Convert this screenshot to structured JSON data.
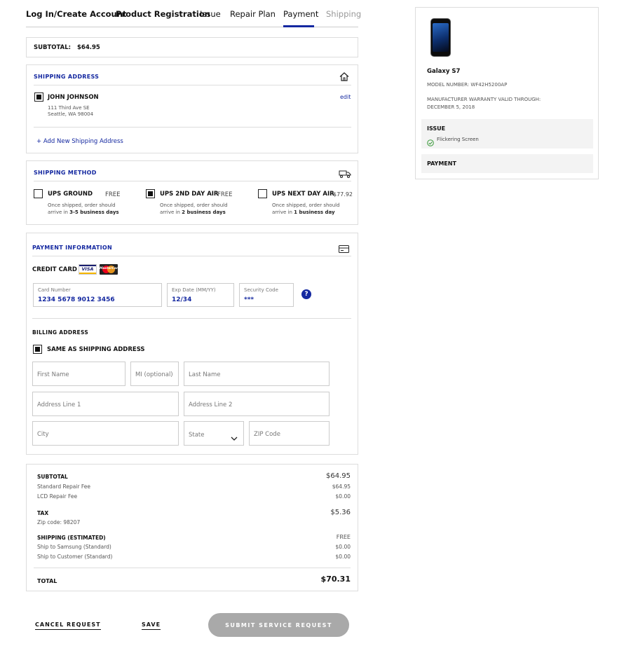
{
  "tabs": [
    {
      "label": "Log In/Create Account"
    },
    {
      "label": "Product Registration"
    },
    {
      "label": "Issue"
    },
    {
      "label": "Repair Plan"
    },
    {
      "label": "Payment"
    },
    {
      "label": "Shipping"
    }
  ],
  "subtotal_bar": {
    "label": "SUBTOTAL:",
    "value": "$64.95"
  },
  "shipping_address": {
    "title": "SHIPPING ADDRESS",
    "name": "JOHN JOHNSON",
    "line1": "111 Third Ave SE",
    "line2": "Seattle, WA 98004",
    "edit": "edit",
    "add_new": "+  Add New Shipping Address"
  },
  "shipping_method": {
    "title": "SHIPPING METHOD",
    "options": [
      {
        "name": "UPS GROUND",
        "price": "FREE",
        "desc_pre": "Once shipped, order should arrive in ",
        "desc_bold": "3-5 business days"
      },
      {
        "name": "UPS 2ND DAY AIR",
        "price": "FREE",
        "desc_pre": "Once shipped, order should arrive in ",
        "desc_bold": "2 business days"
      },
      {
        "name": "UPS NEXT DAY AIR",
        "price": "$77.92",
        "desc_pre": "Once shipped, order should arrive in ",
        "desc_bold": "1 business day"
      }
    ]
  },
  "payment": {
    "title": "PAYMENT INFORMATION",
    "credit_card": "CREDIT CARD",
    "visa": "VISA",
    "mastercard": "MasterCard",
    "card_number_label": "Card Number",
    "card_number_value": "1234 5678 9012 3456",
    "exp_label": "Exp Date (MM/YY)",
    "exp_value": "12/34",
    "cvv_label": "Security Code",
    "cvv_value": "***",
    "help": "?",
    "billing_title": "BILLING ADDRESS",
    "same_as": "SAME AS SHIPPING ADDRESS",
    "placeholders": {
      "first": "First Name",
      "mi": "MI (optional)",
      "last": "Last Name",
      "addr1": "Address Line 1",
      "addr2": "Address Line 2",
      "city": "City",
      "state": "State",
      "zip": "ZIP Code"
    }
  },
  "summary": {
    "subtotal_label": "SUBTOTAL",
    "subtotal_value": "$64.95",
    "standard_fee_label": "Standard Repair Fee",
    "standard_fee_value": "$64.95",
    "lcd_fee_label": "LCD Repair Fee",
    "lcd_fee_value": "$0.00",
    "tax_label": "TAX",
    "tax_value": "$5.36",
    "zip_label": "Zip code: 98207",
    "shipping_label": "SHIPPING (ESTIMATED)",
    "shipping_value": "FREE",
    "ship_samsung_label": "Ship to Samsung (Standard)",
    "ship_samsung_value": "$0.00",
    "ship_customer_label": "Ship to Customer (Standard)",
    "ship_customer_value": "$0.00",
    "total_label": "TOTAL",
    "total_value": "$70.31"
  },
  "actions": {
    "cancel": "CANCEL REQUEST",
    "save": "SAVE",
    "submit": "SUBMIT SERVICE REQUEST"
  },
  "sidebar": {
    "product_name": "Galaxy S7",
    "model": "MODEL NUMBER: WF42H5200AP",
    "warranty": "MANUFACTURER WARRANTY VALID THROUGH: DECEMBER 5, 2018",
    "issue_title": "ISSUE",
    "issue_item": "Flickering Screen",
    "payment_title": "PAYMENT"
  },
  "colors": {
    "accent": "#1428a0",
    "border": "#dddddd",
    "disabled_button": "#a9a9a9"
  }
}
